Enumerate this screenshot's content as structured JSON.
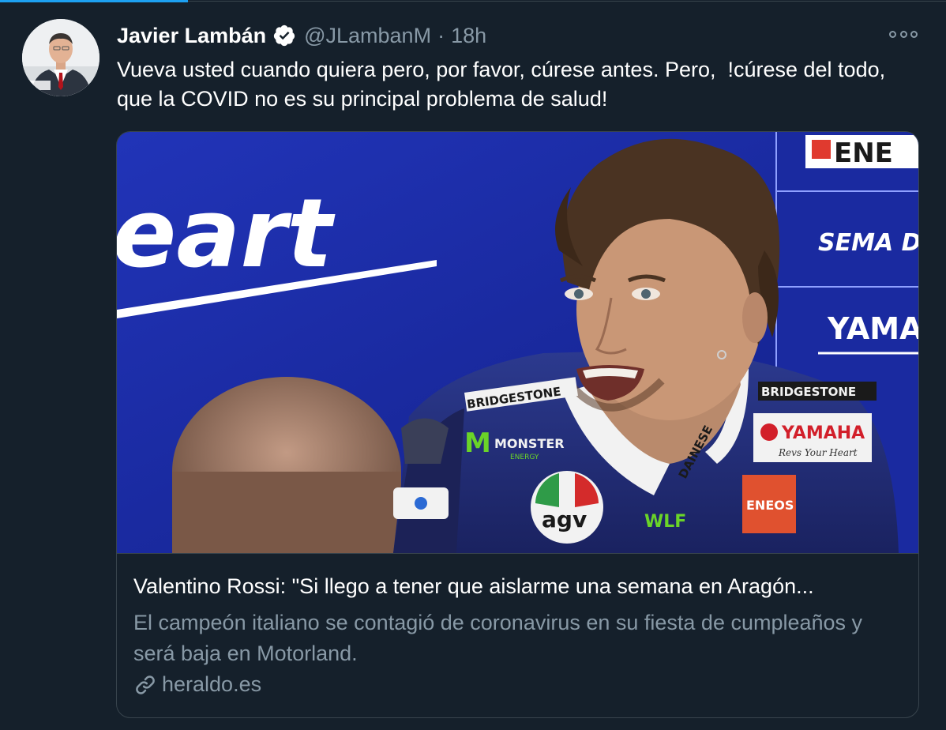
{
  "tweet": {
    "author_name": "Javier Lambán",
    "handle": "@JLambanM",
    "separator": "·",
    "time": "18h",
    "text": "Vueva usted cuando quiera pero, por favor, cúrese antes. Pero,  !cúrese del todo, que la COVID no es su principal problema de salud!"
  },
  "card": {
    "image_text": {
      "banner_left": "eart",
      "top_right": "ENE",
      "mid_right": "SEMA DI DEA",
      "yamaha_right": "YAMAH",
      "bridgestone_1": "BRIDGESTONE",
      "bridgestone_2": "BRIDGESTONE",
      "monster": "MONSTER",
      "energy": "ENERGY",
      "yamaha_patch": "YAMAHA",
      "revs": "Revs Your Heart",
      "eneos": "ENEOS",
      "agv": "agv",
      "wlf": "WLF",
      "dainese": "DAINESE"
    },
    "title": "Valentino Rossi: \"Si llego a tener que aislarme una semana en Aragón...",
    "description": "El campeón italiano se contagió de coronavirus en su fiesta de cumpleaños y será baja en Motorland.",
    "domain": "heraldo.es"
  },
  "icons": {
    "verified": "verified-badge-icon",
    "more": "more-options-icon",
    "link": "link-icon"
  },
  "colors": {
    "background": "#15202b",
    "accent": "#1da1f2",
    "secondary_text": "#8899a6",
    "border": "#38444d"
  }
}
